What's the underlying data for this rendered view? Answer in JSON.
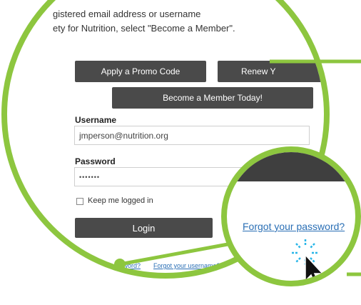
{
  "intro": {
    "line1": "gistered email address or username",
    "line2": "ety for Nutrition, select \"Become a Member\"."
  },
  "buttons": {
    "promo": "Apply a Promo Code",
    "renew": "Renew Y",
    "member": "Become a Member Today!",
    "login": "Login"
  },
  "form": {
    "username_label": "Username",
    "username_value": "jmperson@nutrition.org",
    "password_label": "Password",
    "password_value": "•••••••",
    "remember_label": "Keep me logged in"
  },
  "links": {
    "forgot_password_small": "Forgot your password?",
    "forgot_username_small": "Forgot your username?",
    "forgot_password_zoom": "Forgot your password?"
  },
  "icons": {
    "cursor": "arrow-pointer-click-icon"
  },
  "colors": {
    "accent_green": "#8dc63f",
    "button_dark": "#4a4a4a",
    "link_blue": "#2a6fb5",
    "click_burst": "#29b6e8"
  }
}
